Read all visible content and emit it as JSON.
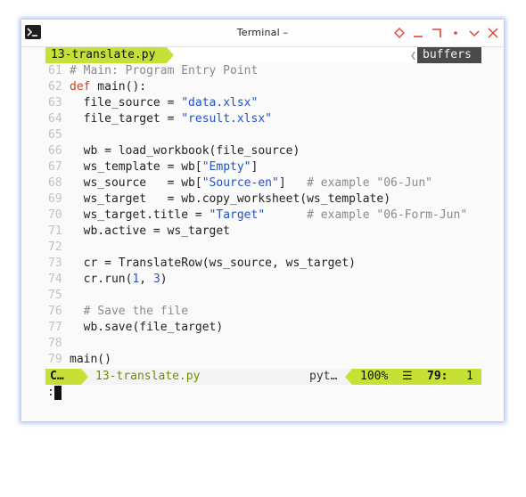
{
  "window": {
    "title": "Terminal –",
    "icon": "terminal-icon",
    "controls": [
      "diamond-icon",
      "minimize-icon",
      "maximize-icon",
      "dot-icon",
      "shade-icon",
      "close-icon"
    ],
    "accent": "#c6e035"
  },
  "tabline": {
    "active_tab": "13-translate.py",
    "buffers_label": "buffers"
  },
  "code": {
    "lines": [
      {
        "n": "61",
        "text": "# Main: Program Entry Point"
      },
      {
        "n": "62",
        "text": "def main():"
      },
      {
        "n": "63",
        "text": "  file_source = \"data.xlsx\""
      },
      {
        "n": "64",
        "text": "  file_target = \"result.xlsx\""
      },
      {
        "n": "65",
        "text": ""
      },
      {
        "n": "66",
        "text": "  wb = load_workbook(file_source)"
      },
      {
        "n": "67",
        "text": "  ws_template = wb[\"Empty\"]"
      },
      {
        "n": "68",
        "text": "  ws_source   = wb[\"Source-en\"]   # example \"06-Jun\""
      },
      {
        "n": "69",
        "text": "  ws_target   = wb.copy_worksheet(ws_template)"
      },
      {
        "n": "70",
        "text": "  ws_target.title = \"Target\"      # example \"06-Form-Jun\""
      },
      {
        "n": "71",
        "text": "  wb.active = ws_target"
      },
      {
        "n": "72",
        "text": ""
      },
      {
        "n": "73",
        "text": "  cr = TranslateRow(ws_source, ws_target)"
      },
      {
        "n": "74",
        "text": "  cr.run(1, 3)"
      },
      {
        "n": "75",
        "text": ""
      },
      {
        "n": "76",
        "text": "  # Save the file"
      },
      {
        "n": "77",
        "text": "  wb.save(file_target)"
      },
      {
        "n": "78",
        "text": ""
      },
      {
        "n": "79",
        "text": "main()"
      }
    ]
  },
  "statusline": {
    "mode": "C…",
    "filename": "13-translate.py",
    "filetype": "pyt…",
    "percent": "100%",
    "menu_icon": "menu-icon",
    "line": "79:",
    "col": "1"
  },
  "cmdline": {
    "prompt": ":"
  }
}
